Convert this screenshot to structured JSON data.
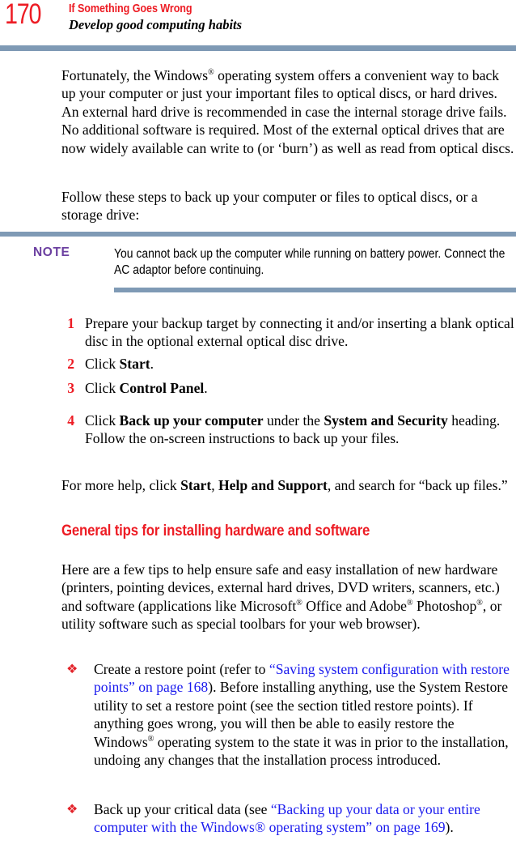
{
  "page": {
    "number": "170",
    "chapter_title": "If Something Goes Wrong",
    "section_title": "Develop good computing habits"
  },
  "colors": {
    "accent_red": "#ED1C24",
    "rule_blue": "#7F9AB5",
    "note_purple": "#6B3FA0",
    "link_blue": "#1A1AEE",
    "bullet_red": "#E3242B"
  },
  "body": {
    "para1_pre": "Fortunately, the Windows",
    "para1_post": " operating system offers a convenient way to back up your computer or just your important files to optical discs, or hard drives. An external hard drive is recommended in case the internal storage drive fails. No additional software is required. Most of the external optical drives that are now widely available can write to (or ‘burn’) as well as read from optical discs.",
    "para2": "Follow these steps to back up your computer or files to optical discs, or a storage drive:"
  },
  "note": {
    "label": "NOTE",
    "text": "You cannot back up the computer while running on battery power. Connect the AC adaptor before continuing."
  },
  "steps": [
    {
      "number": "1",
      "segments": [
        {
          "text": "Prepare your backup target by connecting it and/or inserting a blank optical disc in the optional external optical disc drive.",
          "bold": false
        }
      ]
    },
    {
      "number": "2",
      "segments": [
        {
          "text": "Click ",
          "bold": false
        },
        {
          "text": "Start",
          "bold": true
        },
        {
          "text": ".",
          "bold": false
        }
      ]
    },
    {
      "number": "3",
      "segments": [
        {
          "text": "Click ",
          "bold": false
        },
        {
          "text": "Control Panel",
          "bold": true
        },
        {
          "text": ".",
          "bold": false
        }
      ]
    },
    {
      "number": "4",
      "segments": [
        {
          "text": "Click ",
          "bold": false
        },
        {
          "text": "Back up your computer",
          "bold": true
        },
        {
          "text": " under the ",
          "bold": false
        },
        {
          "text": "System and Security",
          "bold": true
        },
        {
          "text": " heading. Follow the on-screen instructions to back up your files.",
          "bold": false
        }
      ]
    }
  ],
  "help_para": {
    "seg1": "For more help, click ",
    "seg2_bold": "Start",
    "seg3": ", ",
    "seg4_bold": "Help and Support",
    "seg5": ", and search for “back up files.”"
  },
  "section": {
    "heading": "General tips for installing hardware and software",
    "intro_pre": "Here are a few tips to help ensure safe and easy installation of new hardware (printers, pointing devices, external hard drives, DVD writers, scanners, etc.) and software (applications like Microsoft",
    "intro_mid1": " Office and Adobe",
    "intro_mid2": " Photoshop",
    "intro_post": ", or utility software such as special toolbars for your web browser)."
  },
  "bullets": [
    {
      "glyph": "❖",
      "pre": "Create a restore point (refer to ",
      "link": "“Saving system configuration with restore points” on page 168",
      "post": "). Before installing anything, use the System Restore utility to set a restore point (see the section titled restore points). If anything goes wrong, you will then be able to easily restore the Windows",
      "post2": " operating system to the state it was in prior to the installation, undoing any changes that the installation process introduced."
    },
    {
      "glyph": "❖",
      "pre": "Back up your critical data (see ",
      "link": "“Backing up your data or your entire computer with the Windows® operating system” on page 169",
      "post": ").",
      "post2": ""
    }
  ]
}
